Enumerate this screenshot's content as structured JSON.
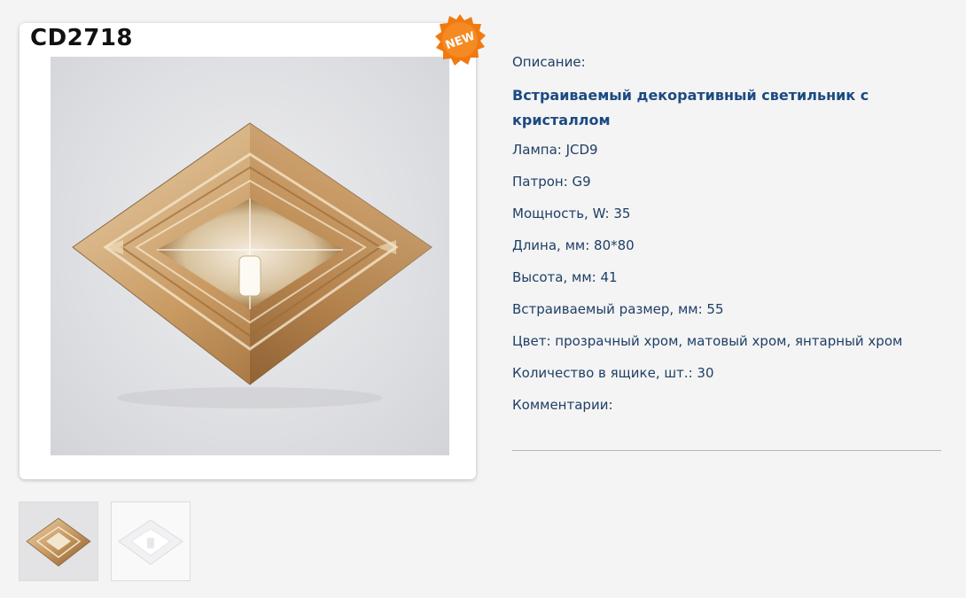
{
  "product": {
    "code": "CD2718",
    "badge": "NEW",
    "description_label": "Описание:",
    "title": "Встраиваемый декоративный светильник с кристаллом",
    "specs": [
      "Лампа: JCD9",
      "Патрон: G9",
      "Мощность, W: 35",
      "Длина, мм: 80*80",
      "Высота, мм: 41",
      "Встраиваемый размер, мм: 55",
      "Цвет: прозрачный хром, матовый хром, янтарный хром",
      "Количество в ящике, шт.: 30",
      "Комментарии:"
    ]
  },
  "thumbnails": [
    {
      "variant": "amber crystal lamp"
    },
    {
      "variant": "clear crystal lamp"
    }
  ],
  "colors": {
    "text": "#1f3f66",
    "title": "#1c4a82",
    "badge": "#f07a10",
    "background": "#f4f4f4"
  }
}
